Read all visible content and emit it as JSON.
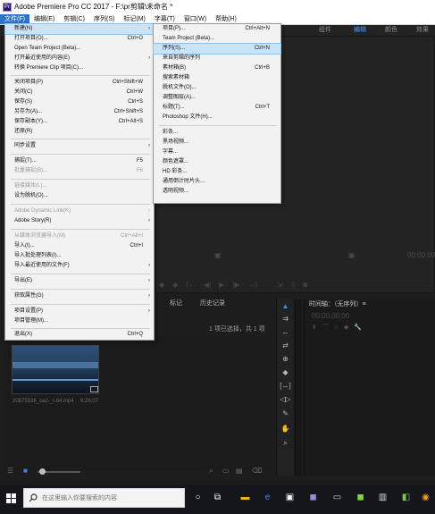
{
  "window": {
    "title": "Adobe Premiere Pro CC 2017 - F:\\pr剪辑\\未命名 *",
    "app_icon": "Pr"
  },
  "menubar": {
    "items": [
      "文件(F)",
      "编辑(E)",
      "剪辑(C)",
      "序列(S)",
      "标记(M)",
      "字幕(T)",
      "窗口(W)",
      "帮助(H)"
    ]
  },
  "workspaces": [
    "组件",
    "编辑",
    "颜色",
    "效果"
  ],
  "file_menu": {
    "items": [
      {
        "label": "新建(N)",
        "shortcut": "",
        "submenu": true
      },
      {
        "label": "打开项目(O)...",
        "shortcut": "Ctrl+O"
      },
      {
        "label": "Open Team Project (Beta)...",
        "shortcut": ""
      },
      {
        "label": "打开最近使用的内容(E)",
        "shortcut": "",
        "submenu": true
      },
      {
        "label": "转换 Premiere Clip 项目(C)...",
        "shortcut": ""
      },
      {
        "label": "关闭项目(P)",
        "shortcut": "Ctrl+Shift+W"
      },
      {
        "label": "关闭(C)",
        "shortcut": "Ctrl+W"
      },
      {
        "label": "保存(S)",
        "shortcut": "Ctrl+S"
      },
      {
        "label": "另存为(A)...",
        "shortcut": "Ctrl+Shift+S"
      },
      {
        "label": "保存副本(Y)...",
        "shortcut": "Ctrl+Alt+S"
      },
      {
        "label": "还原(R)",
        "shortcut": ""
      },
      {
        "label": "同步设置",
        "shortcut": "",
        "submenu": true
      },
      {
        "label": "捕捉(T)...",
        "shortcut": "F5"
      },
      {
        "label": "批量捕捉(B)...",
        "shortcut": "F6"
      },
      {
        "label": "链接媒体(L)...",
        "shortcut": ""
      },
      {
        "label": "设为脱机(O)...",
        "shortcut": ""
      },
      {
        "label": "Adobe Dynamic Link(K)",
        "shortcut": "",
        "submenu": true
      },
      {
        "label": "Adobe Story(R)",
        "shortcut": "",
        "submenu": true
      },
      {
        "label": "从媒体浏览器导入(M)",
        "shortcut": "Ctrl+Alt+I"
      },
      {
        "label": "导入(I)...",
        "shortcut": "Ctrl+I"
      },
      {
        "label": "导入批处理列表(I)...",
        "shortcut": ""
      },
      {
        "label": "导入最近使用的文件(F)",
        "shortcut": "",
        "submenu": true
      },
      {
        "label": "导出(E)",
        "shortcut": "",
        "submenu": true
      },
      {
        "label": "获取属性(G)",
        "shortcut": "",
        "submenu": true
      },
      {
        "label": "项目设置(P)",
        "shortcut": "",
        "submenu": true
      },
      {
        "label": "项目管理(M)...",
        "shortcut": ""
      },
      {
        "label": "退出(X)",
        "shortcut": "Ctrl+Q"
      }
    ]
  },
  "new_submenu": {
    "items": [
      {
        "label": "项目(P)...",
        "shortcut": "Ctrl+Alt+N"
      },
      {
        "label": "Team Project (Beta)...",
        "shortcut": ""
      },
      {
        "label": "序列(S)...",
        "shortcut": "Ctrl+N"
      },
      {
        "label": "来自剪辑的序列",
        "shortcut": ""
      },
      {
        "label": "素材箱(B)",
        "shortcut": "Ctrl+B"
      },
      {
        "label": "搜索素材箱",
        "shortcut": ""
      },
      {
        "label": "脱机文件(O)...",
        "shortcut": ""
      },
      {
        "label": "调整图层(A)...",
        "shortcut": ""
      },
      {
        "label": "标题(T)...",
        "shortcut": "Ctrl+T"
      },
      {
        "label": "Photoshop 文件(H)...",
        "shortcut": ""
      },
      {
        "label": "彩条...",
        "shortcut": ""
      },
      {
        "label": "黑场视频...",
        "shortcut": ""
      },
      {
        "label": "字幕...",
        "shortcut": ""
      },
      {
        "label": "颜色遮罩...",
        "shortcut": ""
      },
      {
        "label": "HD 彩条...",
        "shortcut": ""
      },
      {
        "label": "通用倒计时片头...",
        "shortcut": ""
      },
      {
        "label": "透明视频...",
        "shortcut": ""
      }
    ]
  },
  "monitor": {
    "timecode": "00;00;00"
  },
  "project": {
    "tab_effects": "标记",
    "tab_history": "历史记录",
    "status": "1 项已选择，共 1 项",
    "clip_name": "20875536_ca2-_t-64.mp4",
    "clip_duration": "9;26;07"
  },
  "timeline": {
    "title": "时间轴：（无序列）≡",
    "timecode": "00;00;00;00"
  },
  "taskbar": {
    "search_placeholder": "在这里输入你要搜索的内容"
  }
}
